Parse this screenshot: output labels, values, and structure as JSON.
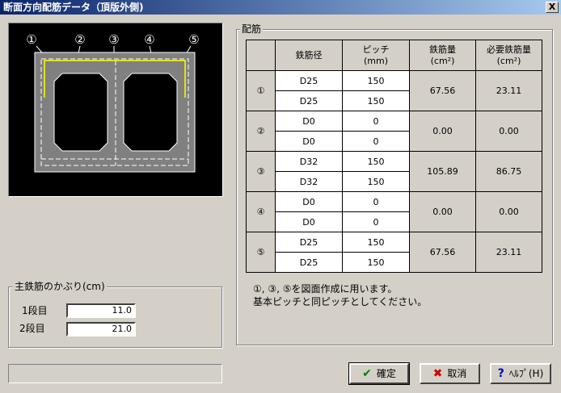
{
  "window": {
    "title": "断面方向配筋データ（頂版外側)",
    "close_label": "X"
  },
  "diagram": {
    "markers": [
      "①",
      "②",
      "③",
      "④",
      "⑤"
    ]
  },
  "cover": {
    "title": "主鉄筋のかぶり(cm)",
    "row1_label": "1段目",
    "row1_value": "11.0",
    "row2_label": "2段目",
    "row2_value": "21.0"
  },
  "rebar": {
    "title": "配筋",
    "headers": {
      "diameter": "鉄筋径",
      "pitch": "ピッチ",
      "pitch_unit": "(mm)",
      "area": "鉄筋量",
      "area_unit": "(cm²)",
      "required": "必要鉄筋量",
      "required_unit": "(cm²)"
    },
    "groups": [
      {
        "mark": "①",
        "rows": [
          {
            "diameter": "D25",
            "pitch": "150"
          },
          {
            "diameter": "D25",
            "pitch": "150"
          }
        ],
        "area": "67.56",
        "required": "23.11"
      },
      {
        "mark": "②",
        "rows": [
          {
            "diameter": "D0",
            "pitch": "0"
          },
          {
            "diameter": "D0",
            "pitch": "0"
          }
        ],
        "area": "0.00",
        "required": "0.00"
      },
      {
        "mark": "③",
        "rows": [
          {
            "diameter": "D32",
            "pitch": "150"
          },
          {
            "diameter": "D32",
            "pitch": "150"
          }
        ],
        "area": "105.89",
        "required": "86.75"
      },
      {
        "mark": "④",
        "rows": [
          {
            "diameter": "D0",
            "pitch": "0"
          },
          {
            "diameter": "D0",
            "pitch": "0"
          }
        ],
        "area": "0.00",
        "required": "0.00"
      },
      {
        "mark": "⑤",
        "rows": [
          {
            "diameter": "D25",
            "pitch": "150"
          },
          {
            "diameter": "D25",
            "pitch": "150"
          }
        ],
        "area": "67.56",
        "required": "23.11"
      }
    ],
    "note_line1": "①, ③, ⑤を図面作成に用います。",
    "note_line2": "基本ピッチと同ピッチとしてください。"
  },
  "buttons": {
    "ok": "確定",
    "cancel": "取消",
    "help": "ﾍﾙﾌﾟ(H)"
  },
  "colors": {
    "title_start": "#0a246a",
    "title_end": "#a6caf0",
    "rebar_highlight": "#ffff00",
    "ok_icon": "#008000",
    "cancel_icon": "#cc0000",
    "help_icon": "#0000cc"
  }
}
